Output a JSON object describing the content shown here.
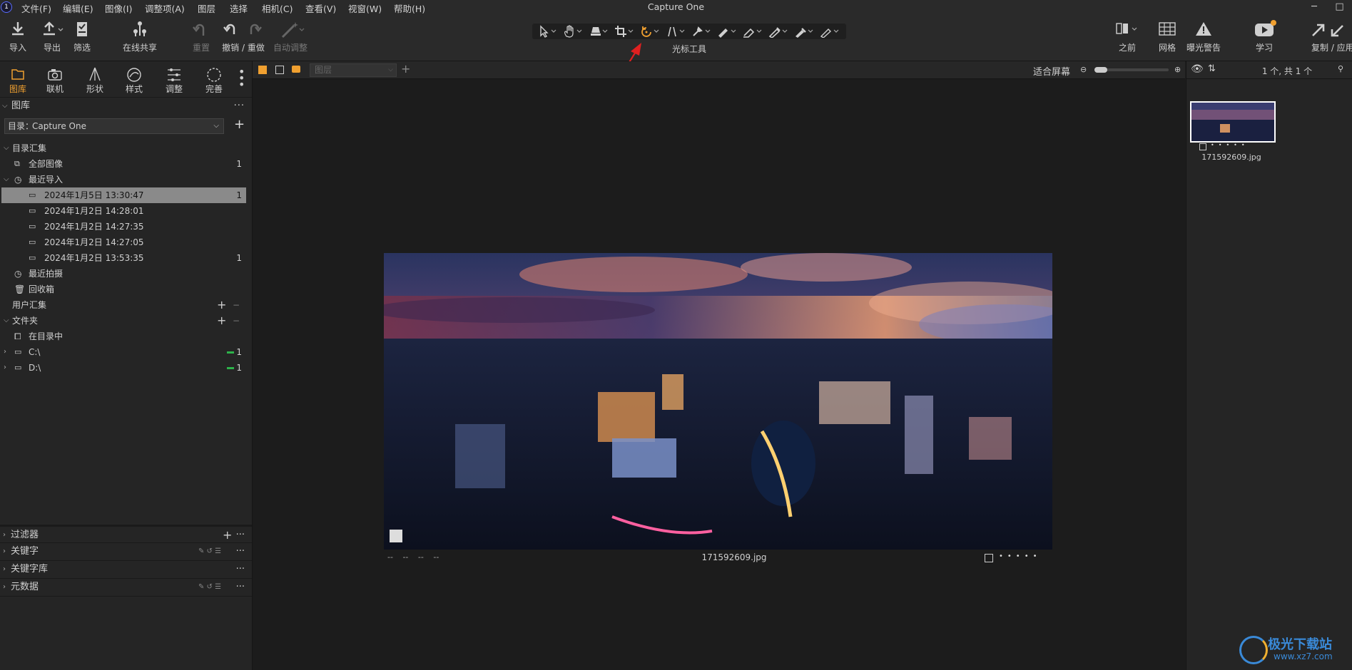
{
  "app_title": "Capture One",
  "menu": [
    "文件(F)",
    "编辑(E)",
    "图像(I)",
    "调整项(A)",
    "图层",
    "选择",
    "相机(C)",
    "查看(V)",
    "视窗(W)",
    "帮助(H)"
  ],
  "window_controls": {
    "minimize": "─",
    "maximize": "□",
    "close": "✕"
  },
  "toolbar": {
    "import": "导入",
    "export": "导出",
    "filter": "筛选",
    "share": "在线共享",
    "reset": "重置",
    "undo_redo": "撤销 / 重做",
    "auto_adjust": "自动调整",
    "cursor_tools": "光标工具",
    "before": "之前",
    "grid": "网格",
    "exposure_warning": "曝光警告",
    "learn": "学习",
    "copy_apply": "复制 / 应用"
  },
  "left_tabs": [
    {
      "label": "图库",
      "icon": "folder-icon",
      "active": true
    },
    {
      "label": "联机",
      "icon": "camera-icon"
    },
    {
      "label": "形状",
      "icon": "lens-icon"
    },
    {
      "label": "样式",
      "icon": "style-icon"
    },
    {
      "label": "调整",
      "icon": "sliders-icon"
    },
    {
      "label": "完善",
      "icon": "refine-icon"
    }
  ],
  "library": {
    "title": "图库",
    "catalog_label": "目录：",
    "catalog_value": "Capture One",
    "catalog_collection": "目录汇集",
    "all_images": {
      "label": "全部图像",
      "count": "1"
    },
    "recent_imports": "最近导入",
    "imports": [
      {
        "label": "2024年1月5日 13:30:47",
        "count": "1",
        "selected": true
      },
      {
        "label": "2024年1月2日 14:28:01",
        "count": ""
      },
      {
        "label": "2024年1月2日 14:27:35",
        "count": ""
      },
      {
        "label": "2024年1月2日 14:27:05",
        "count": ""
      },
      {
        "label": "2024年1月2日 13:53:35",
        "count": "1"
      }
    ],
    "recent_captures": "最近拍摄",
    "trash": "回收箱",
    "user_collections": "用户汇集",
    "folders": "文件夹",
    "in_catalog": "在目录中",
    "drives": [
      {
        "label": "C:\\",
        "count": "1"
      },
      {
        "label": "D:\\",
        "count": "1"
      }
    ]
  },
  "bottom_sections": [
    "过滤器",
    "关键字",
    "关键字库",
    "元数据"
  ],
  "viewer": {
    "layer_placeholder": "图层",
    "fit_label": "适合屏幕",
    "meta_placeholders": [
      "--",
      "--",
      "--",
      "--"
    ],
    "filename": "171592609.jpg"
  },
  "browser": {
    "count_label": "1 个, 共 1 个",
    "thumb_filename": "171592609.jpg"
  },
  "watermark": {
    "text": "极光下载站",
    "url": "www.xz7.com"
  },
  "colors": {
    "accent": "#f0a030",
    "selection": "#8a8a8a",
    "arrow": "#e02020",
    "green": "#2db34a"
  }
}
